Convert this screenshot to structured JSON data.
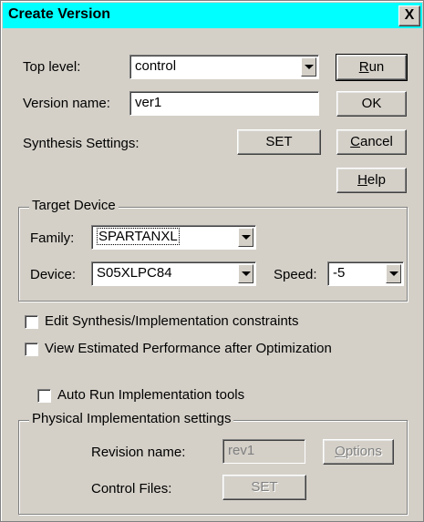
{
  "dialog": {
    "title": "Create Version",
    "close_label": "X"
  },
  "top_level": {
    "label": "Top level:",
    "value": "control"
  },
  "version_name": {
    "label": "Version name:",
    "value": "ver1"
  },
  "synthesis": {
    "label": "Synthesis Settings:",
    "set_label": "SET"
  },
  "buttons": {
    "run_u": "R",
    "run_rest": "un",
    "ok": "OK",
    "cancel_u": "C",
    "cancel_rest": "ancel",
    "help_u": "H",
    "help_rest": "elp"
  },
  "target_device": {
    "group_label": "Target Device",
    "family_label": "Family:",
    "family_value": "SPARTANXL",
    "device_label": "Device:",
    "device_value": "S05XLPC84",
    "speed_label": "Speed:",
    "speed_value": "-5"
  },
  "checkboxes": {
    "edit_constraints": {
      "label": "Edit Synthesis/Implementation constraints",
      "checked": false
    },
    "view_performance": {
      "label": "View Estimated Performance after Optimization",
      "checked": false
    },
    "auto_run": {
      "label": "Auto Run Implementation tools",
      "checked": false
    }
  },
  "physical": {
    "group_label": "Physical Implementation settings",
    "revision_label": "Revision name:",
    "revision_value": "rev1",
    "options_u": "O",
    "options_rest": "ptions",
    "control_label": "Control Files:",
    "control_set_label": "SET"
  }
}
